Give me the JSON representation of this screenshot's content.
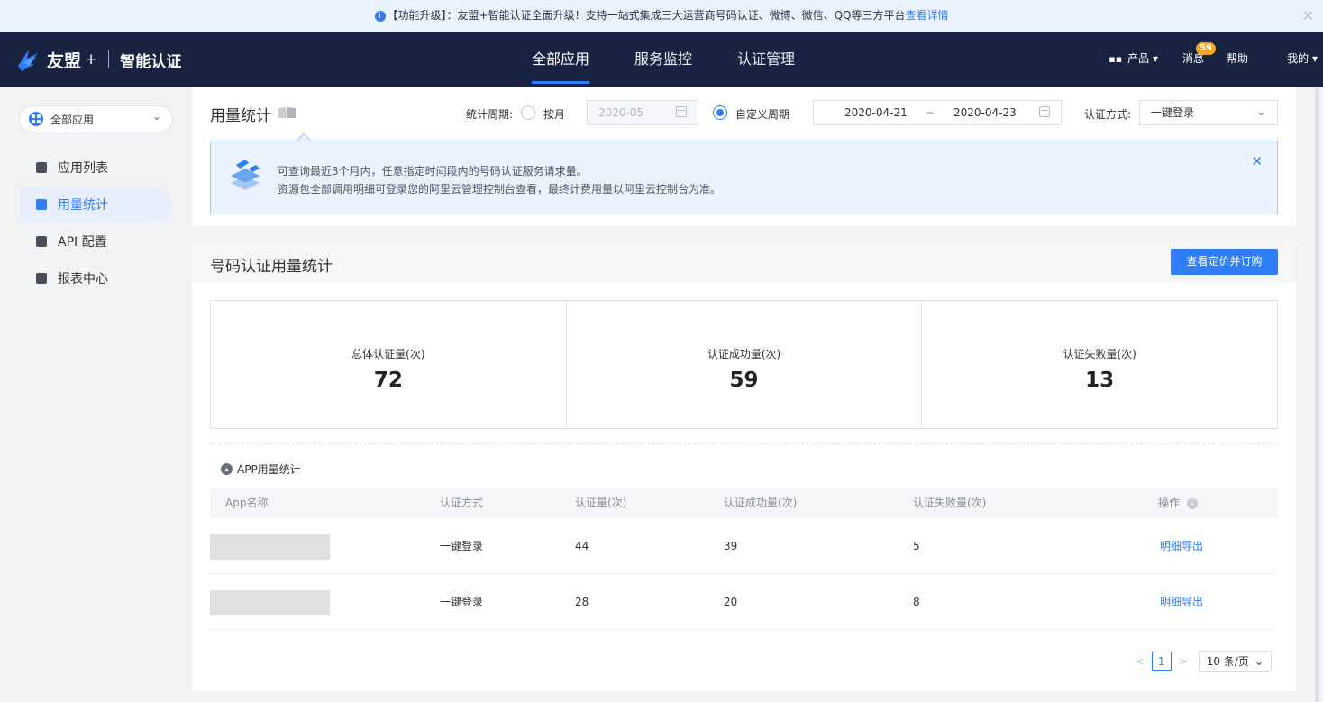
{
  "notice": {
    "text": "【功能升级】：友盟+智能认证全面升级！支持一站式集成三大运营商号码认证、微博、微信、QQ等三方平台",
    "link": "查看详情",
    "close": "✕"
  },
  "brand": {
    "name": "友盟",
    "plus": "+",
    "product": "智能认证"
  },
  "nav": {
    "tabs": [
      {
        "label": "全部应用",
        "active": true
      },
      {
        "label": "服务监控",
        "active": false
      },
      {
        "label": "认证管理",
        "active": false
      }
    ],
    "products": "产品 ▾",
    "messages": "消息",
    "messages_badge": "59",
    "help": "帮助",
    "mine": "我的 ▾"
  },
  "sidebar": {
    "app_select": "全部应用",
    "items": [
      {
        "label": "应用列表",
        "icon": "list-icon",
        "active": false
      },
      {
        "label": "用量统计",
        "icon": "chart-icon",
        "active": true
      },
      {
        "label": "API 配置",
        "icon": "api-icon",
        "active": false
      },
      {
        "label": "报表中心",
        "icon": "report-icon",
        "active": false
      }
    ]
  },
  "filter": {
    "title": "用量统计",
    "period_label": "统计周期:",
    "by_month": "按月",
    "month_value": "2020-05",
    "custom_period": "自定义周期",
    "start_date": "2020-04-21",
    "range_sep": "~",
    "end_date": "2020-04-23",
    "auth_method_label": "认证方式:",
    "auth_method_value": "一键登录"
  },
  "tip": {
    "line1": "可查询最近3个月内，任意指定时间段内的号码认证服务请求量。",
    "line2": "资源包全部调用明细可登录您的阿里云管理控制台查看，最终计费用量以阿里云控制台为准。",
    "close": "✕"
  },
  "stats": {
    "title": "号码认证用量统计",
    "button": "查看定价并订购",
    "kpis": [
      {
        "label": "总体认证量(次)",
        "value": "72"
      },
      {
        "label": "认证成功量(次)",
        "value": "59"
      },
      {
        "label": "认证失败量(次)",
        "value": "13"
      }
    ],
    "app_section": "APP用量统计"
  },
  "table": {
    "headers": [
      "App名称",
      "认证方式",
      "认证量(次)",
      "认证成功量(次)",
      "认证失败量(次)",
      "操作"
    ],
    "rows": [
      {
        "method": "一键登录",
        "total": "44",
        "success": "39",
        "fail": "5",
        "action": "明细导出"
      },
      {
        "method": "一键登录",
        "total": "28",
        "success": "20",
        "fail": "8",
        "action": "明细导出"
      }
    ]
  },
  "pagination": {
    "prev": "<",
    "current": "1",
    "next": ">",
    "page_size": "10 条/页"
  },
  "colors": {
    "primary": "#2f7ef7",
    "nav_bg": "#172340",
    "badge": "#f5a623"
  }
}
